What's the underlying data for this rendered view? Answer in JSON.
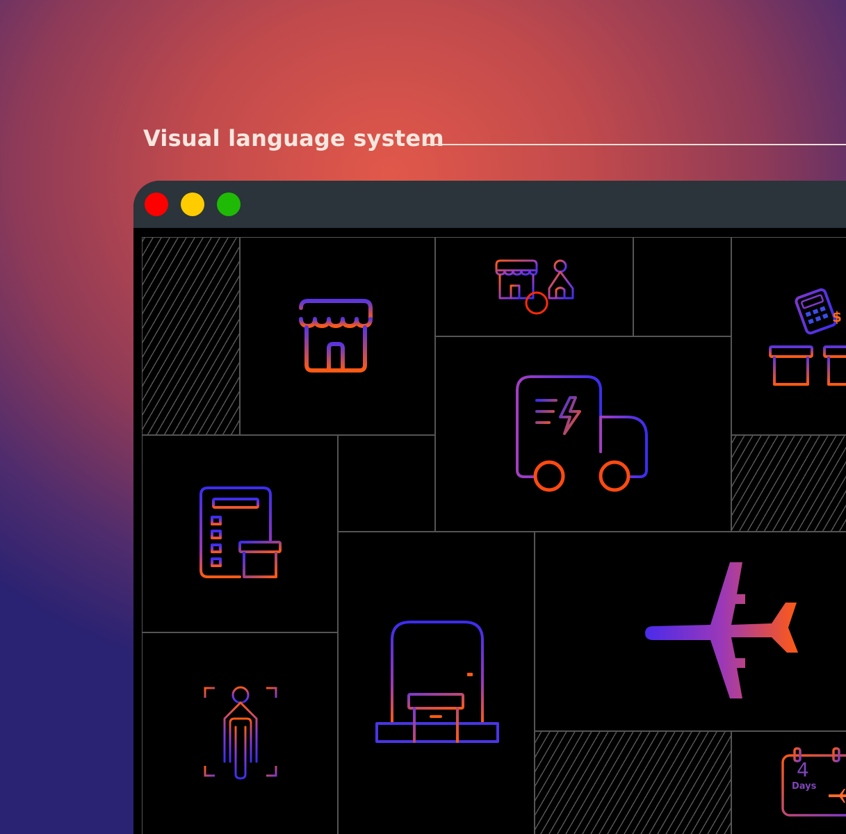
{
  "heading": {
    "text": "Visual language system"
  },
  "window": {
    "controls": [
      "close",
      "minimize",
      "maximize"
    ],
    "colors": {
      "close": "#ff0000",
      "minimize": "#ffcc00",
      "maximize": "#1fba05",
      "titlebar": "#2a343a"
    }
  },
  "palette": {
    "gradient_start": "#3b2df0",
    "gradient_mid": "#9b38b8",
    "gradient_end": "#ff5a12"
  },
  "icons": [
    "storefront-icon",
    "shop-and-user-icon",
    "delivery-truck-icon",
    "calculator-and-boxes-icon",
    "order-checklist-icon",
    "door-with-box-icon",
    "airplane-icon",
    "person-scan-icon",
    "delivery-calendar-icon"
  ],
  "calendar": {
    "number": "4",
    "unit": "Days"
  }
}
